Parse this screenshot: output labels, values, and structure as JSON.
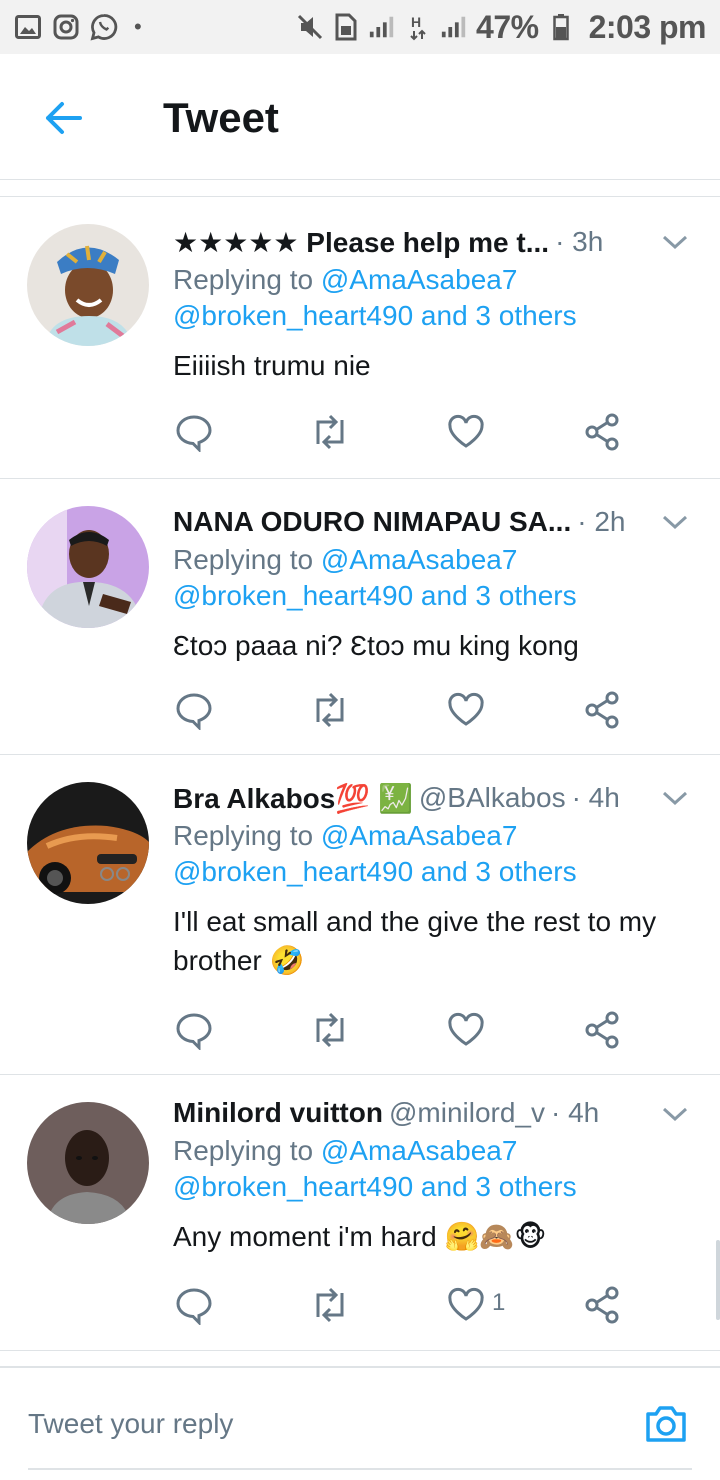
{
  "status_bar": {
    "battery": "47%",
    "time": "2:03 pm",
    "network": "H"
  },
  "header": {
    "title": "Tweet"
  },
  "tweets": [
    {
      "name": "★★★★★ Please help me t...",
      "handle": "",
      "time": "· 3h",
      "replying_prefix": "Replying to ",
      "replying_to": "@AmaAsabea7",
      "mentions": "@broken_heart490 and 3 others",
      "text": "Eiiiish trumu nie",
      "likes": ""
    },
    {
      "name": "NANA ODURO NIMAPAU SA...",
      "handle": "",
      "time": "· 2h",
      "replying_prefix": "Replying to ",
      "replying_to": "@AmaAsabea7",
      "mentions": "@broken_heart490 and 3 others",
      "text": "Ɛtoɔ paaa ni? Ɛtoɔ mu king kong",
      "likes": ""
    },
    {
      "name": "Bra Alkabos💯 💹",
      "handle": "@BAlkabos",
      "time": "· 4h",
      "replying_prefix": "Replying to ",
      "replying_to": "@AmaAsabea7",
      "mentions": "@broken_heart490 and 3 others",
      "text": "I'll eat small and the give the rest to my brother 🤣",
      "likes": ""
    },
    {
      "name": "Minilord vuitton",
      "handle": "@minilord_v",
      "time": "· 4h",
      "replying_prefix": "Replying to ",
      "replying_to": "@AmaAsabea7",
      "mentions": "@broken_heart490 and 3 others",
      "text": "Any moment i'm hard 🤗🙈🐵",
      "likes": "1"
    }
  ],
  "composer": {
    "placeholder": "Tweet your reply"
  },
  "colors": {
    "accent": "#1da1f2",
    "muted": "#657786",
    "text": "#14171a",
    "divider": "#dfe3e6"
  }
}
